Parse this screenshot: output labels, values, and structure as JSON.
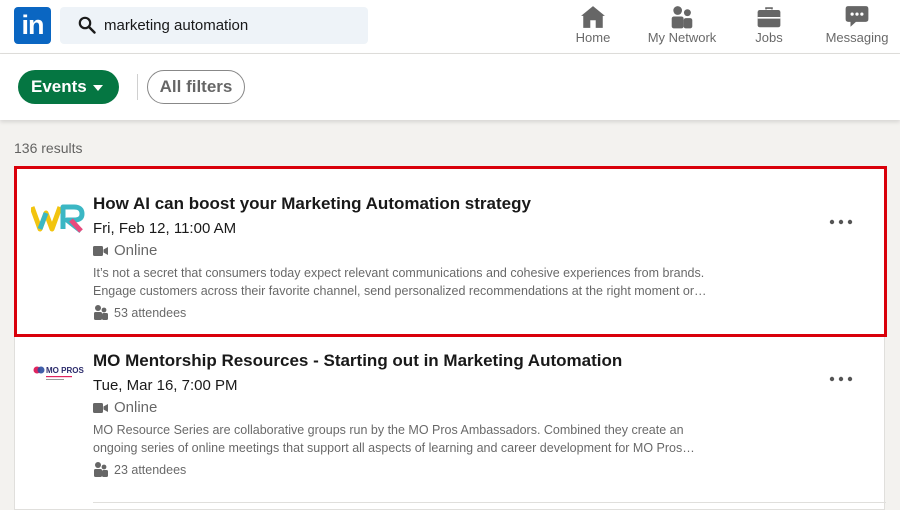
{
  "search": {
    "value": "marketing automation"
  },
  "nav": {
    "logo": "in",
    "home": "Home",
    "network": "My Network",
    "jobs": "Jobs",
    "messaging": "Messaging"
  },
  "filters": {
    "events": "Events",
    "all": "All filters"
  },
  "results_count": "136 results",
  "results": [
    {
      "title": "How AI can boost your Marketing Automation strategy",
      "date": "Fri, Feb 12, 11:00 AM",
      "location": "Online",
      "desc_line1": "It’s not a secret that consumers today expect relevant communications and cohesive experiences from brands.",
      "desc_line2": "Engage customers across their favorite channel, send personalized recommendations at the right moment or…",
      "attendees": "53 attendees",
      "logo_text": "WR"
    },
    {
      "title": "MO Mentorship Resources - Starting out in Marketing Automation",
      "date": "Tue, Mar 16, 7:00 PM",
      "location": "Online",
      "desc_line1": "MO Resource Series are collaborative groups run by the MO Pros Ambassadors. Combined they create an",
      "desc_line2": "ongoing series of online meetings that support all aspects of learning and career development for MO Pros…",
      "attendees": "23 attendees",
      "logo_text": "MO PROS"
    }
  ],
  "colors": {
    "accent": "#0a66c2",
    "events_btn": "#057642",
    "highlight": "#d9000a"
  }
}
